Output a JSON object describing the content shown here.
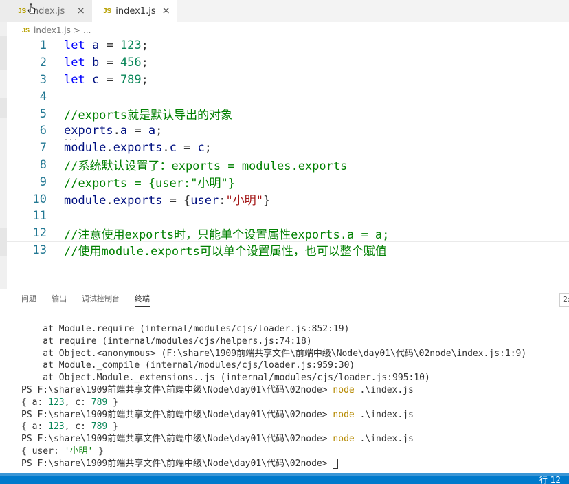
{
  "tabs": [
    {
      "icon": "JS",
      "label": "index.js",
      "close": "×"
    },
    {
      "icon": "JS",
      "label": "index1.js",
      "close": "×"
    }
  ],
  "breadcrumb": {
    "icon": "JS",
    "file": "index1.js",
    "sep": ">",
    "more": "..."
  },
  "editor": {
    "line_numbers": [
      "1",
      "2",
      "3",
      "4",
      "5",
      "6",
      "7",
      "8",
      "9",
      "10",
      "11",
      "12",
      "13"
    ],
    "lines": [
      [
        {
          "t": "let",
          "c": "kw"
        },
        {
          "t": " "
        },
        {
          "t": "a",
          "c": "var"
        },
        {
          "t": " = "
        },
        {
          "t": "123",
          "c": "num"
        },
        {
          "t": ";"
        }
      ],
      [
        {
          "t": "let",
          "c": "kw"
        },
        {
          "t": " "
        },
        {
          "t": "b",
          "c": "var"
        },
        {
          "t": " = "
        },
        {
          "t": "456",
          "c": "num"
        },
        {
          "t": ";"
        }
      ],
      [
        {
          "t": "let",
          "c": "kw"
        },
        {
          "t": " "
        },
        {
          "t": "c",
          "c": "var"
        },
        {
          "t": " = "
        },
        {
          "t": "789",
          "c": "num"
        },
        {
          "t": ";"
        }
      ],
      [],
      [
        {
          "t": "//exports就是默认导出的对象",
          "c": "cm"
        }
      ],
      [
        {
          "t": "exports",
          "c": "var"
        },
        {
          "t": "."
        },
        {
          "t": "a",
          "c": "var"
        },
        {
          "t": " = "
        },
        {
          "t": "a",
          "c": "var"
        },
        {
          "t": ";"
        }
      ],
      [
        {
          "t": "module",
          "c": "var"
        },
        {
          "t": "."
        },
        {
          "t": "exports",
          "c": "var"
        },
        {
          "t": "."
        },
        {
          "t": "c",
          "c": "var"
        },
        {
          "t": " = "
        },
        {
          "t": "c",
          "c": "var"
        },
        {
          "t": ";"
        }
      ],
      [
        {
          "t": "//系统默认设置了：exports = modules.exports",
          "c": "cm"
        }
      ],
      [
        {
          "t": "//exports = {user:\"小明\"}",
          "c": "cm"
        }
      ],
      [
        {
          "t": "module",
          "c": "var"
        },
        {
          "t": "."
        },
        {
          "t": "exports",
          "c": "var"
        },
        {
          "t": " = {"
        },
        {
          "t": "user",
          "c": "var"
        },
        {
          "t": ":"
        },
        {
          "t": "\"小明\"",
          "c": "str"
        },
        {
          "t": "}"
        }
      ],
      [],
      [
        {
          "t": "//注意使用exports时，只能单个设置属性exports.a = a;",
          "c": "cm"
        }
      ],
      [
        {
          "t": "//使用module.exports可以单个设置属性，也可以整个赋值",
          "c": "cm"
        }
      ]
    ],
    "current_line": 12,
    "squiggle": "···"
  },
  "panel": {
    "tabs": [
      "问题",
      "输出",
      "调试控制台",
      "终端"
    ],
    "active_tab": 3,
    "terminal_select": "2:"
  },
  "terminal": {
    "lines": [
      [
        {
          "t": "    at Module.require (internal/modules/cjs/loader.js:852:19)"
        }
      ],
      [
        {
          "t": "    at require (internal/modules/cjs/helpers.js:74:18)"
        }
      ],
      [
        {
          "t": "    at Object.<anonymous> (F:\\share\\1909前端共享文件\\前端中级\\Node\\day01\\代码\\02node\\index.js:1:9)"
        }
      ],
      [
        {
          "t": "    at Module._compile (internal/modules/cjs/loader.js:959:30)"
        }
      ],
      [
        {
          "t": "    at Object.Module._extensions..js (internal/modules/cjs/loader.js:995:10)"
        }
      ],
      [
        {
          "t": "PS F:\\share\\1909前端共享文件\\前端中级\\Node\\day01\\代码\\02node> "
        },
        {
          "t": "node",
          "c": "cmd"
        },
        {
          "t": " .\\index.js"
        }
      ],
      [
        {
          "t": "{ a: "
        },
        {
          "t": "123",
          "c": "tnum"
        },
        {
          "t": ", c: "
        },
        {
          "t": "789",
          "c": "tnum"
        },
        {
          "t": " }"
        }
      ],
      [
        {
          "t": "PS F:\\share\\1909前端共享文件\\前端中级\\Node\\day01\\代码\\02node> "
        },
        {
          "t": "node",
          "c": "cmd"
        },
        {
          "t": " .\\index.js"
        }
      ],
      [
        {
          "t": "{ a: "
        },
        {
          "t": "123",
          "c": "tnum"
        },
        {
          "t": ", c: "
        },
        {
          "t": "789",
          "c": "tnum"
        },
        {
          "t": " }"
        }
      ],
      [
        {
          "t": "PS F:\\share\\1909前端共享文件\\前端中级\\Node\\day01\\代码\\02node> "
        },
        {
          "t": "node",
          "c": "cmd"
        },
        {
          "t": " .\\index.js"
        }
      ],
      [
        {
          "t": "{ user: "
        },
        {
          "t": "'小明'",
          "c": "tstr"
        },
        {
          "t": " }"
        }
      ],
      [
        {
          "t": "PS F:\\share\\1909前端共享文件\\前端中级\\Node\\day01\\代码\\02node> "
        }
      ]
    ]
  },
  "status": {
    "position": "行 12"
  }
}
